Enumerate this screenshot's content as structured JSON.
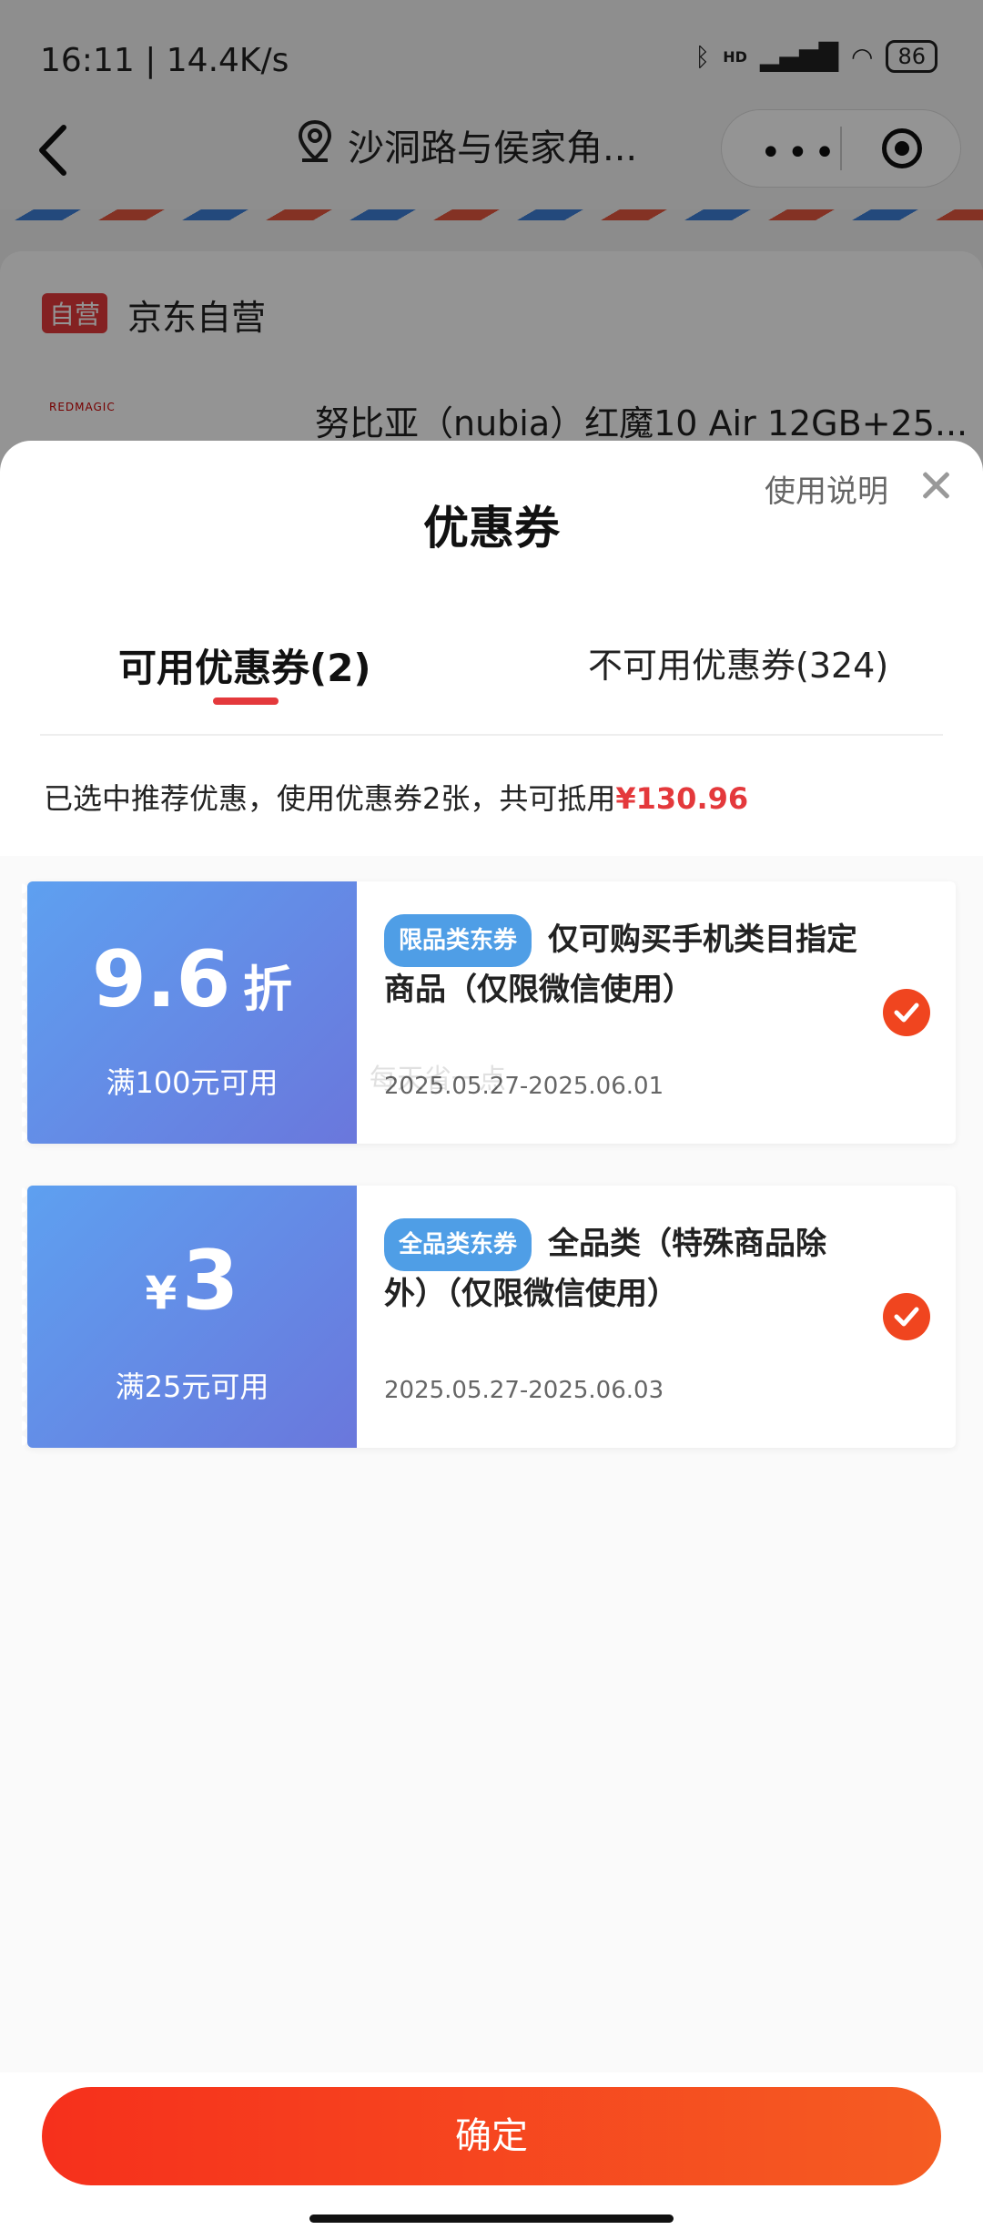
{
  "status_bar": {
    "time": "16:11 | 14.4K/s",
    "battery": "86",
    "network": "HD"
  },
  "nav": {
    "location": "沙洞路与侯家角..."
  },
  "store": {
    "badge": "自营",
    "name": "京东自营"
  },
  "product": {
    "logo_text": "REDMAGIC",
    "title": "努比亚（nubia）红魔10 Air 12GB+25..."
  },
  "sheet": {
    "title": "优惠券",
    "usage_link": "使用说明",
    "tabs": [
      {
        "label": "可用优惠券(2)",
        "active": true
      },
      {
        "label": "不可用优惠券(324)",
        "active": false
      }
    ],
    "summary_prefix": "已选中推荐优惠，使用优惠券2张，共可抵用",
    "summary_amount": "¥130.96"
  },
  "coupons": [
    {
      "value": "9.6",
      "unit": "折",
      "condition": "满100元可用",
      "tag": "限品类东券",
      "desc": "仅可购买手机类目指定商品（仅限微信使用）",
      "date": "2025.05.27-2025.06.01",
      "selected": true
    },
    {
      "currency": "¥",
      "value": "3",
      "condition": "满25元可用",
      "tag": "全品类东券",
      "desc": "全品类（特殊商品除外）（仅限微信使用）",
      "date": "2025.05.27-2025.06.03",
      "selected": true
    }
  ],
  "watermark": "每天省一点",
  "confirm_label": "确定",
  "colors": {
    "accent": "#e4393c",
    "confirm": "#f6301c",
    "coupon_blue": "#5ea0f0",
    "check": "#f0451f"
  }
}
